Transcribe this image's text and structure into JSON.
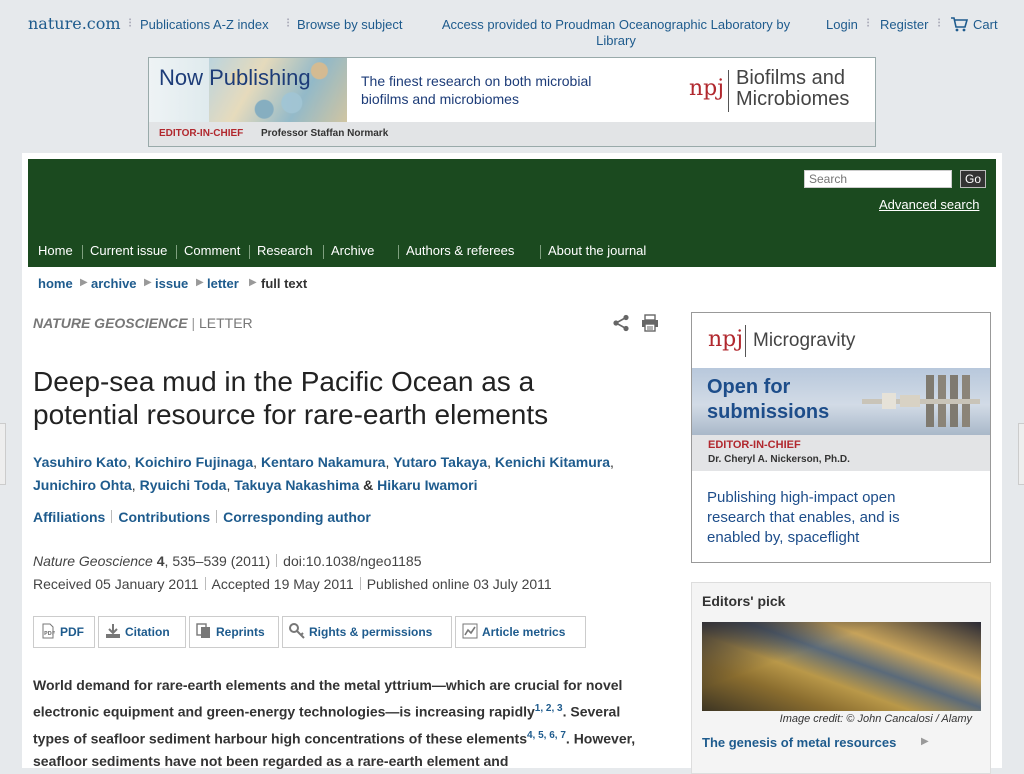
{
  "topbar": {
    "logo": "nature.com",
    "pubs_az": "Publications A-Z index",
    "browse": "Browse by subject",
    "access": "Access provided to  Proudman Oceanographic Laboratory  by Library",
    "login": "Login",
    "register": "Register",
    "cart": "Cart"
  },
  "banner": {
    "now_publishing": "Now Publishing",
    "tagline": "The finest research on both microbial biofilms and microbiomes",
    "npj": "npj",
    "journal": "Biofilms and Microbiomes",
    "eic_label": "EDITOR-IN-CHIEF",
    "eic_name": "Professor Staffan Normark"
  },
  "header": {
    "search_placeholder": "Search",
    "go": "Go",
    "advanced": "Advanced search",
    "nav": [
      "Home",
      "Current issue",
      "Comment",
      "Research",
      "Archive",
      "Authors & referees",
      "About the journal"
    ]
  },
  "breadcrumb": [
    "home",
    "archive",
    "issue",
    "letter",
    "full text"
  ],
  "article": {
    "journal": "NATURE GEOSCIENCE",
    "type": "LETTER",
    "title": "Deep-sea mud in the Pacific Ocean as a potential resource for rare-earth elements",
    "authors": [
      "Yasuhiro Kato",
      "Koichiro Fujinaga",
      "Kentaro Nakamura",
      "Yutaro Takaya",
      "Kenichi Kitamura",
      "Junichiro Ohta",
      "Ryuichi Toda",
      "Takuya Nakashima",
      "Hikaru Iwamori"
    ],
    "links": [
      "Affiliations",
      "Contributions",
      "Corresponding author"
    ],
    "citation": {
      "journal": "Nature Geoscience",
      "volume": "4",
      "pages": "535–539",
      "year": "(2011)",
      "doi": "doi:10.1038/ngeo1185"
    },
    "dates": {
      "received": "Received  05 January 2011",
      "accepted": "Accepted  19 May 2011",
      "published": "Published online  03 July 2011"
    },
    "tools": [
      "PDF",
      "Citation",
      "Reprints",
      "Rights & permissions",
      "Article metrics"
    ],
    "abstract": {
      "p1": "World demand for rare-earth elements and the metal yttrium—which are crucial for novel electronic equipment and green-energy technologies—is increasing rapidly",
      "refs1": "1, 2, 3",
      "p2": ". Several types of seafloor sediment harbour high concentrations of these elements",
      "refs2": "4, 5, 6, 7",
      "p3": ". However, seafloor sediments have not been regarded as a rare-earth element and"
    }
  },
  "ad_right": {
    "npj": "npj",
    "journal": "Microgravity",
    "open": "Open for submissions",
    "eic_label": "EDITOR-IN-CHIEF",
    "eic_name": "Dr. Cheryl A. Nickerson, Ph.D.",
    "tagline": "Publishing high-impact open research that enables, and is enabled by, spaceflight"
  },
  "editors_pick": {
    "heading": "Editors' pick",
    "credit": "Image credit: © John Cancalosi / Alamy",
    "link": "The genesis of metal resources"
  },
  "colors": {
    "header_green": "#1b4a1f",
    "link_blue": "#1e5b8d",
    "npj_red": "#b1282e"
  }
}
